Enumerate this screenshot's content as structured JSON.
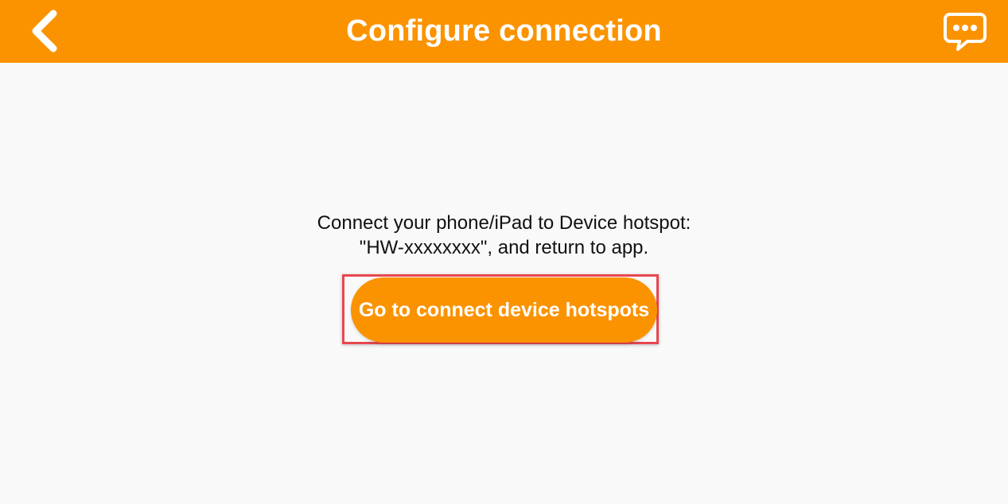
{
  "header": {
    "title": "Configure connection",
    "back_icon": "chevron-left-icon",
    "chat_icon": "chat-bubble-icon"
  },
  "main": {
    "instruction_line1": "Connect your phone/iPad to Device hotspot:",
    "instruction_line2": "\"HW-xxxxxxxx\", and return to app.",
    "connect_button_label": "Go to connect device hotspots"
  },
  "colors": {
    "accent": "#fb9300",
    "background": "#f9f9f9",
    "highlight": "#e8474f",
    "text": "#111111"
  }
}
